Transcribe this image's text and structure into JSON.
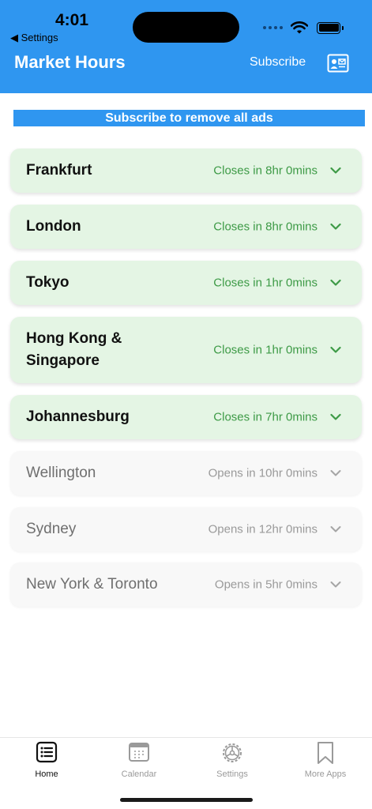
{
  "status_bar": {
    "time": "4:01",
    "back_label": "◀ Settings"
  },
  "header": {
    "title": "Market Hours",
    "subscribe_label": "Subscribe",
    "profile_icon": "contact-card-icon"
  },
  "ad_banner": {
    "text": "Subscribe to remove all ads"
  },
  "markets": [
    {
      "name": "Frankfurt",
      "status": "Closes in 8hr 0mins",
      "state": "open"
    },
    {
      "name": "London",
      "status": "Closes in 8hr 0mins",
      "state": "open"
    },
    {
      "name": "Tokyo",
      "status": "Closes in 1hr 0mins",
      "state": "open"
    },
    {
      "name_line1": "Hong Kong &",
      "name_line2": "Singapore",
      "status": "Closes in 1hr 0mins",
      "state": "open"
    },
    {
      "name": "Johannesburg",
      "status": "Closes in 7hr 0mins",
      "state": "open"
    },
    {
      "name": "Wellington",
      "status": "Opens in 10hr 0mins",
      "state": "closed"
    },
    {
      "name": "Sydney",
      "status": "Opens in 12hr 0mins",
      "state": "closed"
    },
    {
      "name": "New York & Toronto",
      "status": "Opens in 5hr 0mins",
      "state": "closed"
    }
  ],
  "tabs": [
    {
      "label": "Home",
      "icon": "list-icon",
      "active": true
    },
    {
      "label": "Calendar",
      "icon": "calendar-icon",
      "active": false
    },
    {
      "label": "Settings",
      "icon": "gear-icon",
      "active": false
    },
    {
      "label": "More Apps",
      "icon": "bookmark-icon",
      "active": false
    }
  ],
  "colors": {
    "header_bg": "#2f96f0",
    "open_card_bg": "#e4f5e4",
    "open_status": "#3d9a46",
    "closed_card_bg": "#f8f8f8",
    "closed_status": "#9a9a9a"
  }
}
